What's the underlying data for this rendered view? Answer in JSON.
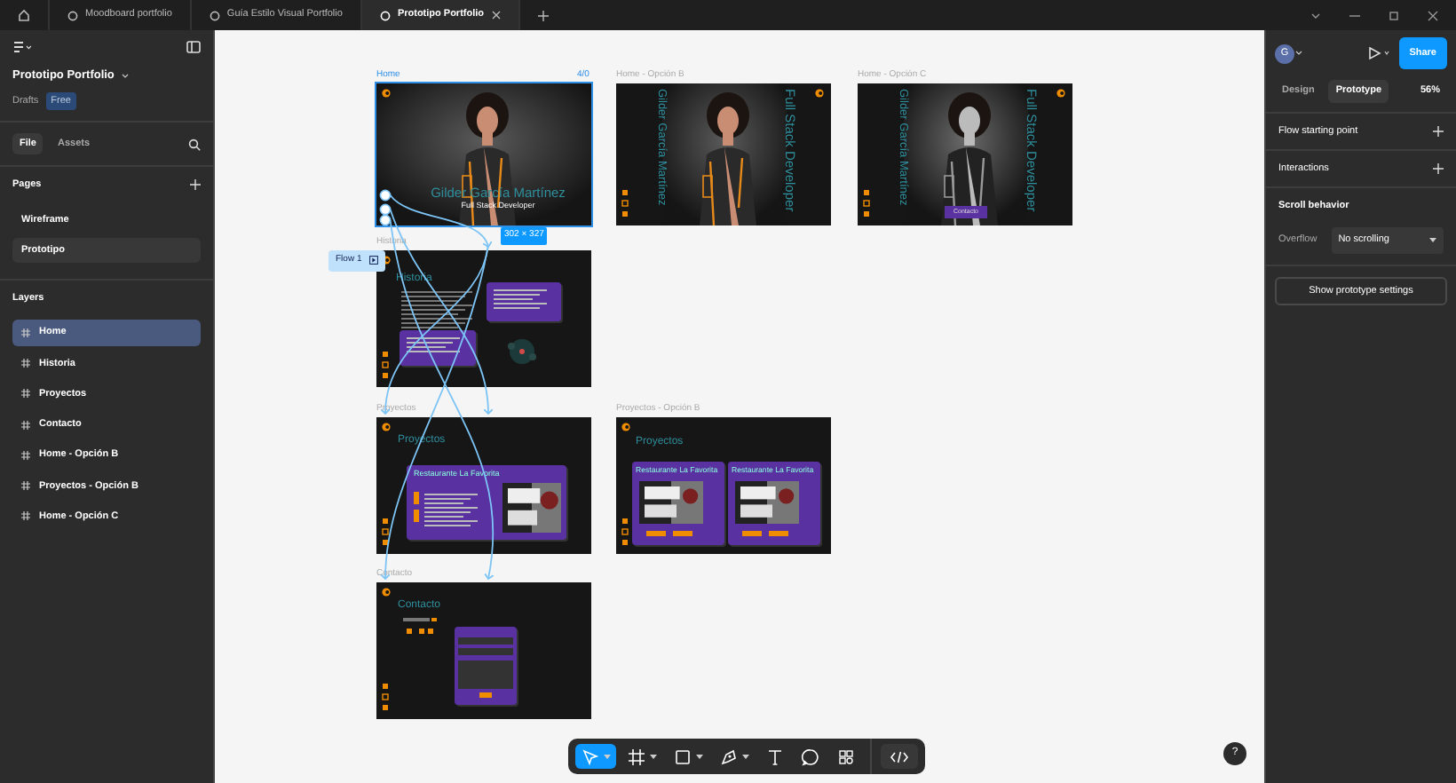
{
  "tabs": [
    {
      "label": "Moodboard portfolio",
      "selected": false,
      "closable": false
    },
    {
      "label": "Guía Estilo Visual Portfolio",
      "selected": false,
      "closable": false
    },
    {
      "label": "Prototipo Portfolio",
      "selected": true,
      "closable": true
    }
  ],
  "file": {
    "name": "Prototipo Portfolio",
    "location": "Drafts",
    "plan": "Free"
  },
  "sidebar_tabs": [
    {
      "label": "File",
      "selected": true
    },
    {
      "label": "Assets",
      "selected": false
    }
  ],
  "pages": {
    "title": "Pages",
    "items": [
      {
        "label": "Wireframe",
        "selected": false
      },
      {
        "label": "Prototipo",
        "selected": true
      }
    ]
  },
  "layers": {
    "title": "Layers",
    "items": [
      {
        "label": "Home",
        "selected": true
      },
      {
        "label": "Historia",
        "selected": false
      },
      {
        "label": "Proyectos",
        "selected": false
      },
      {
        "label": "Contacto",
        "selected": false
      },
      {
        "label": "Home - Opción B",
        "selected": false
      },
      {
        "label": "Proyectos - Opción B",
        "selected": false
      },
      {
        "label": "Home - Opción C",
        "selected": false
      }
    ]
  },
  "canvas": {
    "frames": [
      {
        "name": "Home",
        "kind": "home",
        "selected": true,
        "counter": "4/0",
        "heading": "Gilder García Martínez",
        "subheading": "Full Stack Developer"
      },
      {
        "name": "Home - Opción B",
        "kind": "home_b",
        "selected": false,
        "heading": "Gilder García Martínez",
        "subheading": "Full Stack Developer"
      },
      {
        "name": "Home - Opción C",
        "kind": "home_c",
        "selected": false,
        "heading": "Gilder García Martínez",
        "subheading": "Full Stack Developer",
        "button": "Contacto"
      },
      {
        "name": "Historia",
        "kind": "historia",
        "selected": false,
        "heading": "Historia"
      },
      {
        "name": "Proyectos",
        "kind": "proyectos",
        "selected": false,
        "heading": "Proyectos",
        "card_title": "Restaurante La Favorita"
      },
      {
        "name": "Proyectos - Opción B",
        "kind": "proyectos_b",
        "selected": false,
        "heading": "Proyectos",
        "cards": [
          "Restaurante La Favorita",
          "Restaurante La Favorita"
        ]
      },
      {
        "name": "Contacto",
        "kind": "contacto",
        "selected": false,
        "heading": "Contacto"
      }
    ],
    "flow": "Flow 1",
    "size_badge": "302 × 327"
  },
  "toolbar": [
    {
      "kind": "move",
      "selected": true,
      "menu": true
    },
    {
      "kind": "frame",
      "selected": false,
      "menu": true
    },
    {
      "kind": "rectangle",
      "selected": false,
      "menu": true
    },
    {
      "kind": "pen",
      "selected": false,
      "menu": true
    },
    {
      "kind": "text",
      "selected": false,
      "menu": false
    },
    {
      "kind": "comment",
      "selected": false,
      "menu": false
    },
    {
      "kind": "components",
      "selected": false,
      "menu": false
    },
    {
      "kind": "dev",
      "selected": false,
      "menu": false
    }
  ],
  "right_panel": {
    "avatar": "G",
    "share": "Share",
    "tabs": [
      {
        "label": "Design",
        "selected": false
      },
      {
        "label": "Prototype",
        "selected": true
      }
    ],
    "zoom": "56%",
    "sections": [
      "Flow starting point",
      "Interactions"
    ],
    "scroll": {
      "title": "Scroll behavior",
      "label": "Overflow",
      "value": "No scrolling"
    },
    "settings_button": "Show prototype settings"
  },
  "help": "?"
}
